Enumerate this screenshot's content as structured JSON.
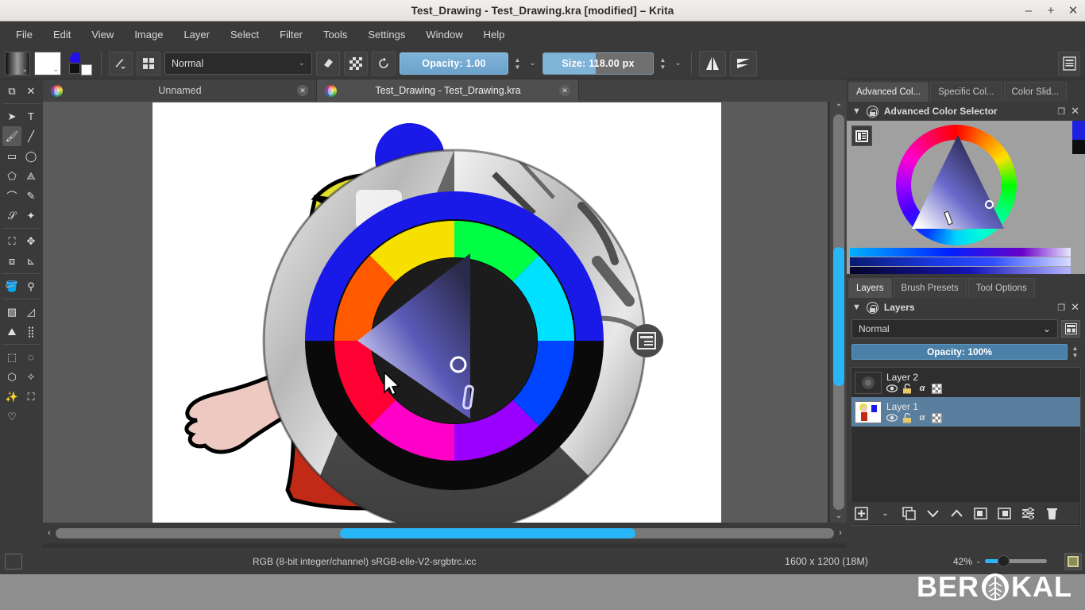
{
  "window": {
    "title": "Test_Drawing - Test_Drawing.kra [modified] – Krita",
    "minimize": "–",
    "maximize": "+",
    "close": "✕"
  },
  "menubar": {
    "items": [
      "File",
      "Edit",
      "View",
      "Image",
      "Layer",
      "Select",
      "Filter",
      "Tools",
      "Settings",
      "Window",
      "Help"
    ]
  },
  "toolbar": {
    "gradient_caret": "⌄",
    "pattern_caret": "⌄",
    "brush_editor_icon": "✎",
    "presets_icon": "▦",
    "blending_mode": "Normal",
    "blending_caret": "⌄",
    "eraser_icon": "◆",
    "alpha_icon": "▩",
    "reload_icon": "↻",
    "opacity_label": "Opacity:  1.00",
    "opacity_value": "1.00",
    "size_label": "Size:  118.00 px",
    "size_value": "118.00 px",
    "mirror_h_icon": "◭",
    "mirror_v_icon": "▶",
    "workspace_icon": "▤",
    "accent_blue": "#6fa8d0",
    "fg_color": "#2311e8",
    "bg_color": "#ffffff"
  },
  "toolbox": {
    "tools": [
      {
        "name": "transform-a-layer-icon",
        "glyph": "⧉"
      },
      {
        "name": "close-icon",
        "glyph": "✕"
      },
      {
        "name": "select-shapes-icon",
        "glyph": "➤"
      },
      {
        "name": "text-tool-icon",
        "glyph": "T"
      },
      {
        "name": "freehand-brush-icon",
        "glyph": "🖌"
      },
      {
        "name": "line-tool-icon",
        "glyph": "╱"
      },
      {
        "name": "rectangle-tool-icon",
        "glyph": "▭"
      },
      {
        "name": "ellipse-tool-icon",
        "glyph": "◯"
      },
      {
        "name": "polygon-tool-icon",
        "glyph": "⬠"
      },
      {
        "name": "polyline-tool-icon",
        "glyph": "⟁"
      },
      {
        "name": "bezier-curve-icon",
        "glyph": "⌒"
      },
      {
        "name": "freehand-path-icon",
        "glyph": "✎"
      },
      {
        "name": "dynamic-brush-icon",
        "glyph": "𝒮"
      },
      {
        "name": "multibrush-icon",
        "glyph": "✦"
      },
      {
        "name": "crop-tool-icon",
        "glyph": "⛶"
      },
      {
        "name": "move-tool-icon",
        "glyph": "✥"
      },
      {
        "name": "transform-tool-icon",
        "glyph": "⧈"
      },
      {
        "name": "measure-tool-icon",
        "glyph": "⊾"
      },
      {
        "name": "fill-tool-icon",
        "glyph": "🪣"
      },
      {
        "name": "color-picker-icon",
        "glyph": "⚲"
      },
      {
        "name": "gradient-tool-icon",
        "glyph": "▨"
      },
      {
        "name": "assistant-tool-icon",
        "glyph": "◿"
      },
      {
        "name": "perspective-grid-icon",
        "glyph": "⛰"
      },
      {
        "name": "grid-tool-icon",
        "glyph": "⣿"
      },
      {
        "name": "rectangular-select-icon",
        "glyph": "⬚"
      },
      {
        "name": "elliptical-select-icon",
        "glyph": "◌"
      },
      {
        "name": "polygonal-select-icon",
        "glyph": "⬡"
      },
      {
        "name": "freehand-select-icon",
        "glyph": "✧"
      },
      {
        "name": "contiguous-select-icon",
        "glyph": "✨"
      },
      {
        "name": "similar-color-select-icon",
        "glyph": "⛶"
      },
      {
        "name": "bezier-select-icon",
        "glyph": "♡"
      }
    ]
  },
  "tabs": [
    {
      "label": "Unnamed",
      "active": false,
      "close": "✕"
    },
    {
      "label": "Test_Drawing - Test_Drawing.kra",
      "active": true,
      "close": "✕"
    }
  ],
  "right_dockers": {
    "color_tabs": [
      {
        "label": "Advanced Col...",
        "active": true
      },
      {
        "label": "Specific Col...",
        "active": false
      },
      {
        "label": "Color Slid...",
        "active": false
      }
    ],
    "color_selector_title": "Advanced Color Selector",
    "collapse_icon": "▼",
    "float_icon": "❐",
    "close_icon": "✕",
    "settings_icon": "▤",
    "layer_tabs": [
      {
        "label": "Layers",
        "active": true
      },
      {
        "label": "Brush Presets",
        "active": false
      },
      {
        "label": "Tool Options",
        "active": false
      }
    ],
    "layers_title": "Layers",
    "blending_mode": "Normal",
    "blending_caret": "⌄",
    "filter_icon": "▦",
    "opacity_label": "Opacity:  100%",
    "opacity_value": "100%",
    "spin_icon": "⇕",
    "layers": [
      {
        "name": "Layer 2",
        "selected": false,
        "visible_icon": "👁",
        "lock_icon": "🔓",
        "alpha_icon": "α",
        "checker_icon": "checkerboard"
      },
      {
        "name": "Layer 1",
        "selected": true,
        "visible_icon": "👁",
        "lock_icon": "🔓",
        "alpha_icon": "α",
        "checker_icon": "checkerboard"
      }
    ],
    "layer_buttons": [
      {
        "name": "add-layer-button",
        "glyph": "⊞"
      },
      {
        "name": "add-layer-dropdown",
        "glyph": "⌄"
      },
      {
        "name": "duplicate-layer-button",
        "glyph": "❐"
      },
      {
        "name": "move-layer-down-button",
        "glyph": "⌄"
      },
      {
        "name": "move-layer-up-button",
        "glyph": "⌃"
      },
      {
        "name": "layer-properties-button",
        "glyph": "⊡"
      },
      {
        "name": "layer-mask-button",
        "glyph": "⊡"
      },
      {
        "name": "layer-filters-button",
        "glyph": "☰"
      },
      {
        "name": "delete-layer-button",
        "glyph": "🗑"
      }
    ]
  },
  "statusbar": {
    "colorspace": "RGB (8-bit integer/channel)  sRGB-elle-V2-srgbtrc.icc",
    "dimensions": "1600 x 1200 (18M)",
    "zoom": "42%",
    "zoom_caret": "⌄",
    "right_icon": "▣"
  },
  "watermark": {
    "text_left": "BER",
    "text_right": "KAL"
  },
  "canvas": {
    "description": "Cartoon woman illustration with Krita pop-up color palette overlay",
    "popup_palette_icon": "▤",
    "scroll_h_pos": "36.5%",
    "scroll_v_pos": "183px"
  }
}
